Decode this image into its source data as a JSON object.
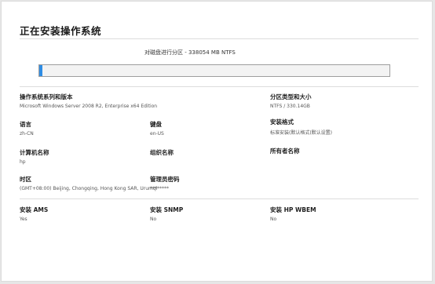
{
  "title": "正在安装操作系统",
  "status_text": "对磁盘进行分区 - 338054 MB NTFS",
  "progress": 0.01,
  "accent_color": "#2f8de4",
  "fields": {
    "os": {
      "label": "操作系统系列和版本",
      "value": "Microsoft Windows Server 2008 R2, Enterprise x64 Edition"
    },
    "partition": {
      "label": "分区类型和大小",
      "value": "NTFS / 330.14GB"
    },
    "language": {
      "label": "语言",
      "value": "zh-CN"
    },
    "keyboard": {
      "label": "键盘",
      "value": "en-US"
    },
    "install_format": {
      "label": "安装格式",
      "value": "标准安装(默认格式(默认设置)"
    },
    "computer_name": {
      "label": "计算机名称",
      "value": "hp"
    },
    "org_name": {
      "label": "组织名称",
      "value": ""
    },
    "owner_name": {
      "label": "所有者名称",
      "value": ""
    },
    "timezone": {
      "label": "时区",
      "value": "(GMT+08:00) Beijing, Chongqing, Hong Kong SAR, Urumqi"
    },
    "admin_password": {
      "label": "管理员密码",
      "value": "********"
    },
    "ams": {
      "label": "安装 AMS",
      "value": "Yes"
    },
    "snmp": {
      "label": "安装 SNMP",
      "value": "No"
    },
    "wbem": {
      "label": "安装 HP WBEM",
      "value": "No"
    }
  }
}
